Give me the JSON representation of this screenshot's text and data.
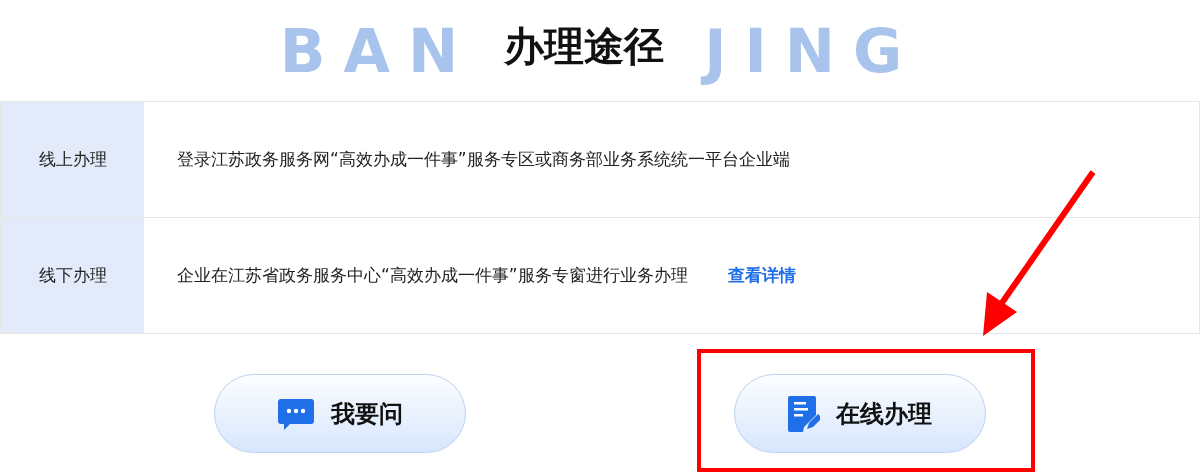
{
  "header": {
    "title": "办理途径",
    "watermark_left": "BAN",
    "watermark_right": "JING"
  },
  "rows": [
    {
      "label": "线上办理",
      "text": "登录江苏政务服务网“高效办成一件事”服务专区或商务部业务系统统一平台企业端"
    },
    {
      "label": "线下办理",
      "text": "企业在江苏省政务服务中心“高效办成一件事”服务专窗进行业务办理",
      "link": "查看详情"
    }
  ],
  "buttons": [
    {
      "label": "我要问",
      "kind": "chat"
    },
    {
      "label": "在线办理",
      "kind": "form"
    }
  ]
}
